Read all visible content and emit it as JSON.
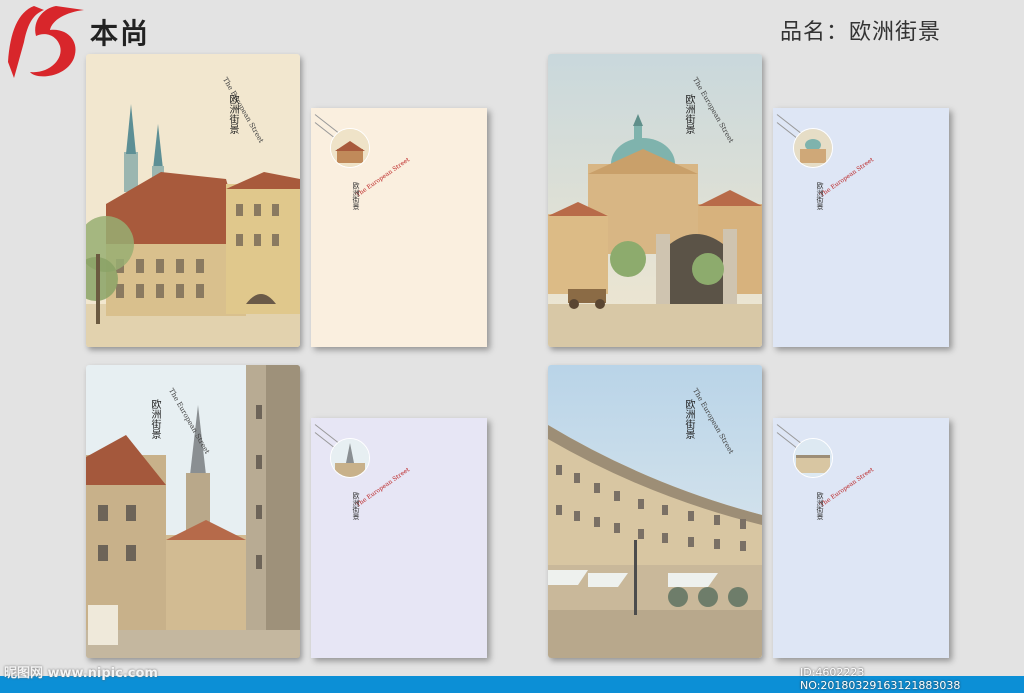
{
  "header": {
    "brand": "本尚",
    "product_label": "品名：欧洲街景"
  },
  "stationery": {
    "script_title": "The European Street",
    "han_chars": "欧洲街景"
  },
  "footer": {
    "watermark": "昵图网 www.nipic.com",
    "id_text": "ID:4602223 NO:20180329163121883038"
  },
  "colors": {
    "logo_red": "#d8262b",
    "footer_blue": "#0c8fd6",
    "sheet_cream": "#faefdf",
    "sheet_blue": "#dee6f5",
    "sheet_lavender": "#e7e6f5"
  }
}
